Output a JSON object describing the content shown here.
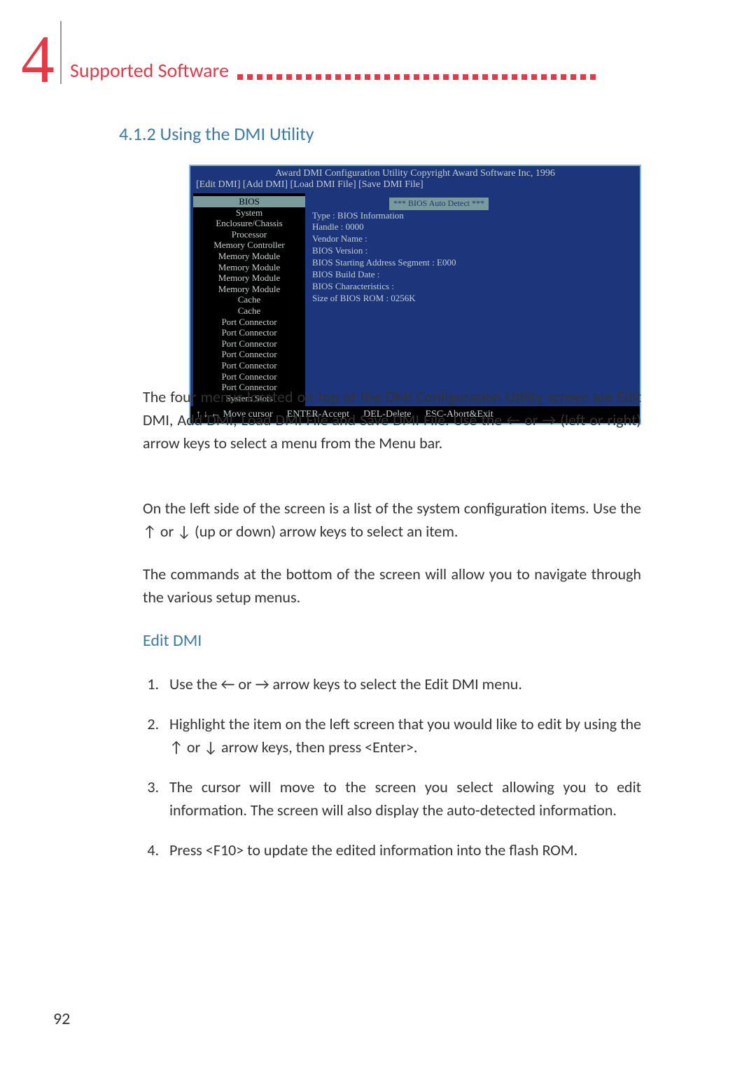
{
  "chapter": {
    "number": "4",
    "title": "Supported Software"
  },
  "section": {
    "title": "4.1.2 Using the DMI Utility"
  },
  "utility": {
    "header": "Award DMI Configuration Utility Copyright Award Software Inc, 1996",
    "menus": "[Edit DMI]   [Add DMI]   [Load DMI File]   [Save DMI File]",
    "left_items": {
      "selected": "BIOS",
      "items": [
        "System",
        "Enclosure/Chassis",
        "Processor",
        "Memory Controller",
        "Memory Module",
        "Memory Module",
        "Memory Module",
        "Memory Module",
        "Cache",
        "Cache",
        "Port Connector",
        "Port Connector",
        "Port Connector",
        "Port Connector",
        "Port Connector",
        "Port Connector",
        "Port Connector",
        "System Slots"
      ]
    },
    "right": {
      "auto_detect": "***  BIOS Auto Detect  ***",
      "lines": [
        "Type  :  BIOS Information",
        "Handle  :  0000",
        "   Vendor Name   :",
        "   BIOS Version   :",
        "   BIOS Starting Address Segment   :  E000",
        "   BIOS Build Date   :",
        "   BIOS Characteristics   :",
        "   Size of BIOS ROM  :  0256K"
      ]
    },
    "footer": {
      "cursor": "↑  ↓  ←  Move cursor",
      "enter": "ENTER-Accept",
      "del": "DEL-Delete",
      "esc": "ESC-Abort&Exit"
    }
  },
  "paragraphs": {
    "p1": "The four menus located on top of the DMI Configuration Utility screen are Edit DMI, Add DMI, Load DMI File and Save DMI File. Use the ← or → (left or right) arrow keys to select a menu from the Menu bar.",
    "p2": "On the left side of the screen is a list of the system configuration items. Use the ↑ or ↓ (up or down) arrow keys to select an item.",
    "p3": "The commands at the bottom of the screen will allow you to navigate through the various setup menus."
  },
  "sub_heading": "Edit DMI",
  "list_items": {
    "i1": "Use the ← or → arrow keys to select the Edit DMI menu.",
    "i2": "Highlight the item on the left screen that you would like to edit by using the ↑ or ↓ arrow keys, then press <Enter>.",
    "i3": "The cursor will move to the screen you select allowing you to edit information. The screen will also display the auto-detected information.",
    "i4": "Press <F10> to update the edited information into the flash ROM."
  },
  "page_number": "92"
}
